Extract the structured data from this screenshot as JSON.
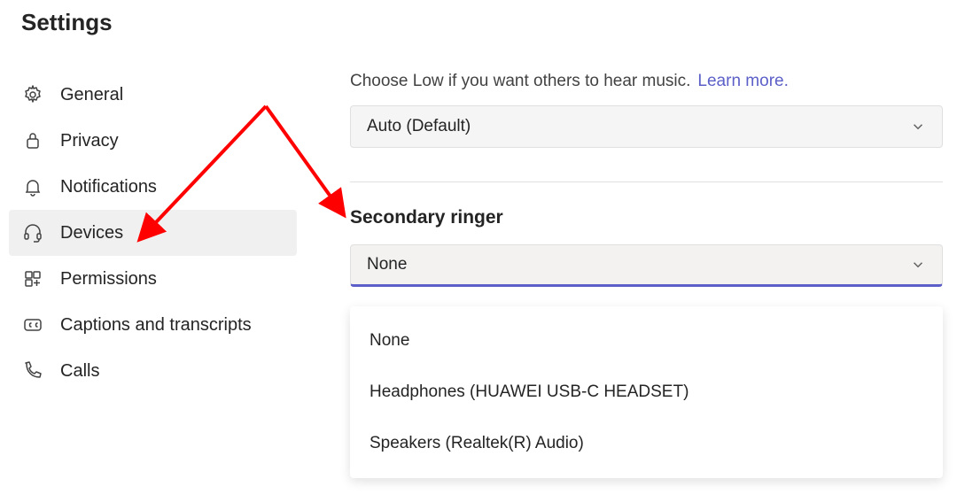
{
  "title": "Settings",
  "sidebar": {
    "items": [
      {
        "label": "General",
        "iconName": "gear-icon"
      },
      {
        "label": "Privacy",
        "iconName": "lock-icon"
      },
      {
        "label": "Notifications",
        "iconName": "bell-icon"
      },
      {
        "label": "Devices",
        "iconName": "headset-icon"
      },
      {
        "label": "Permissions",
        "iconName": "app-grid-icon"
      },
      {
        "label": "Captions and transcripts",
        "iconName": "captions-icon"
      },
      {
        "label": "Calls",
        "iconName": "phone-icon"
      }
    ]
  },
  "noise": {
    "hint": "Choose Low if you want others to hear music.",
    "learnMore": "Learn more.",
    "selected": "Auto (Default)"
  },
  "ringer": {
    "heading": "Secondary ringer",
    "selected": "None",
    "options": [
      "None",
      "Headphones (HUAWEI USB-C HEADSET)",
      "Speakers (Realtek(R) Audio)"
    ]
  }
}
